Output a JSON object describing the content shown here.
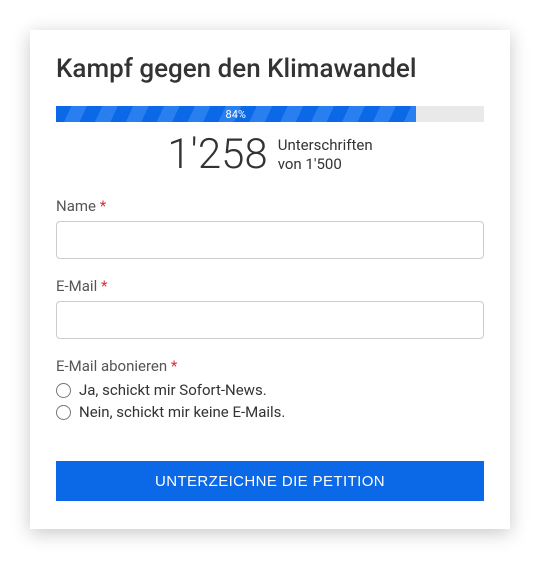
{
  "title": "Kampf gegen den Klimawandel",
  "progress": {
    "percent_label": "84%",
    "width": "84%"
  },
  "counter": {
    "count": "1'258",
    "unit": "Unterschriften",
    "goal_line": "von 1'500"
  },
  "fields": {
    "name_label": "Name",
    "email_label": "E-Mail",
    "subscribe_label": "E-Mail abonieren",
    "required_mark": "*"
  },
  "subscribe_options": {
    "yes": "Ja, schickt mir Sofort-News.",
    "no": "Nein, schickt mir keine E-Mails."
  },
  "submit_label": "UNTERZEICHNE DIE PETITION"
}
